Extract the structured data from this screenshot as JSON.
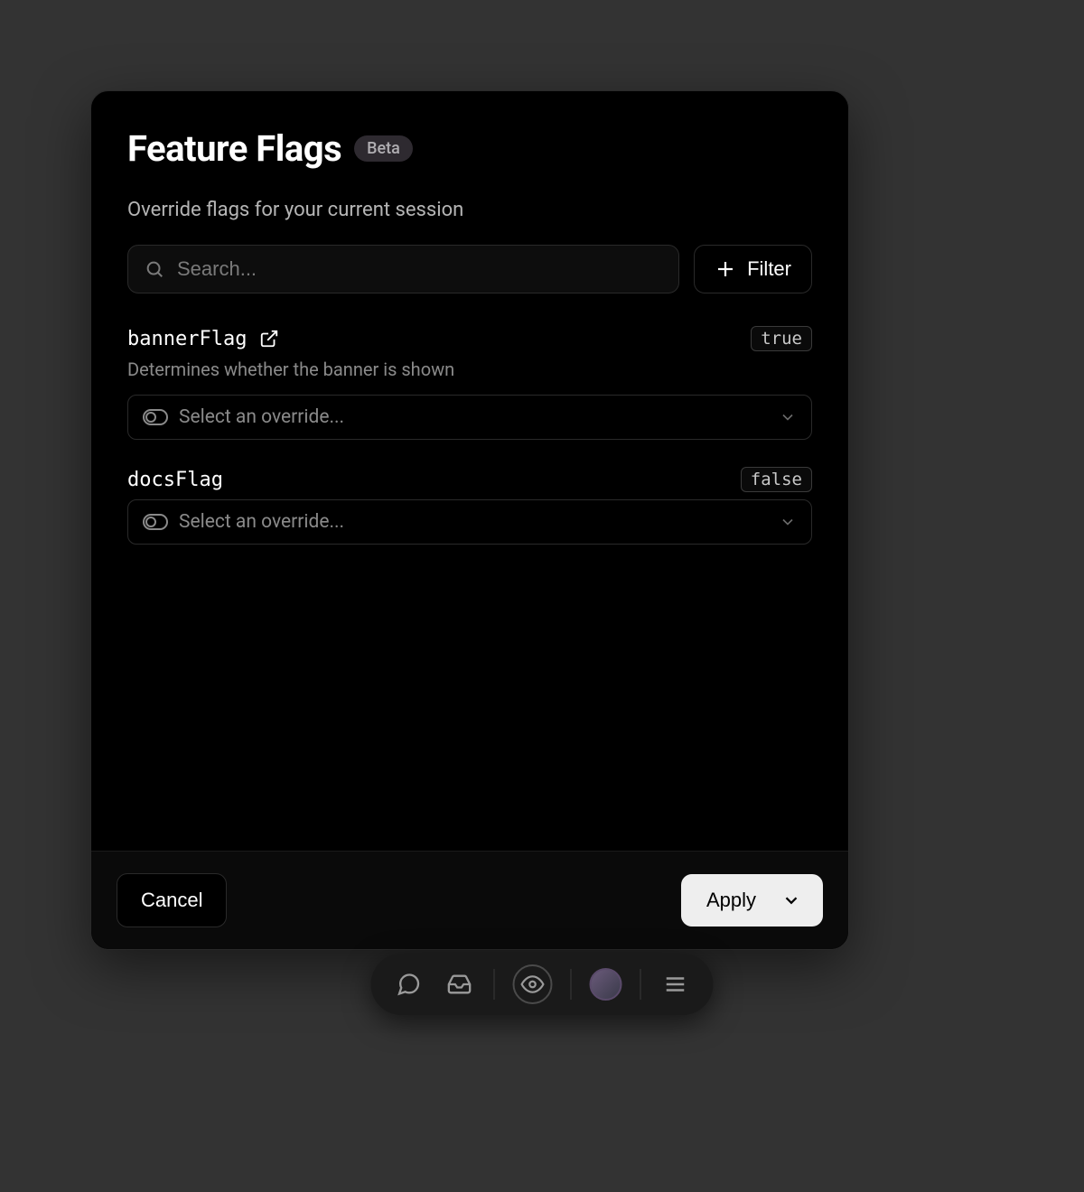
{
  "modal": {
    "title": "Feature Flags",
    "badge": "Beta",
    "subtitle": "Override flags for your current session",
    "search_placeholder": "Search...",
    "filter_label": "Filter",
    "override_placeholder": "Select an override...",
    "cancel_label": "Cancel",
    "apply_label": "Apply"
  },
  "flags": [
    {
      "name": "bannerFlag",
      "has_link": true,
      "value": "true",
      "description": "Determines whether the banner is shown"
    },
    {
      "name": "docsFlag",
      "has_link": false,
      "value": "false",
      "description": ""
    }
  ]
}
